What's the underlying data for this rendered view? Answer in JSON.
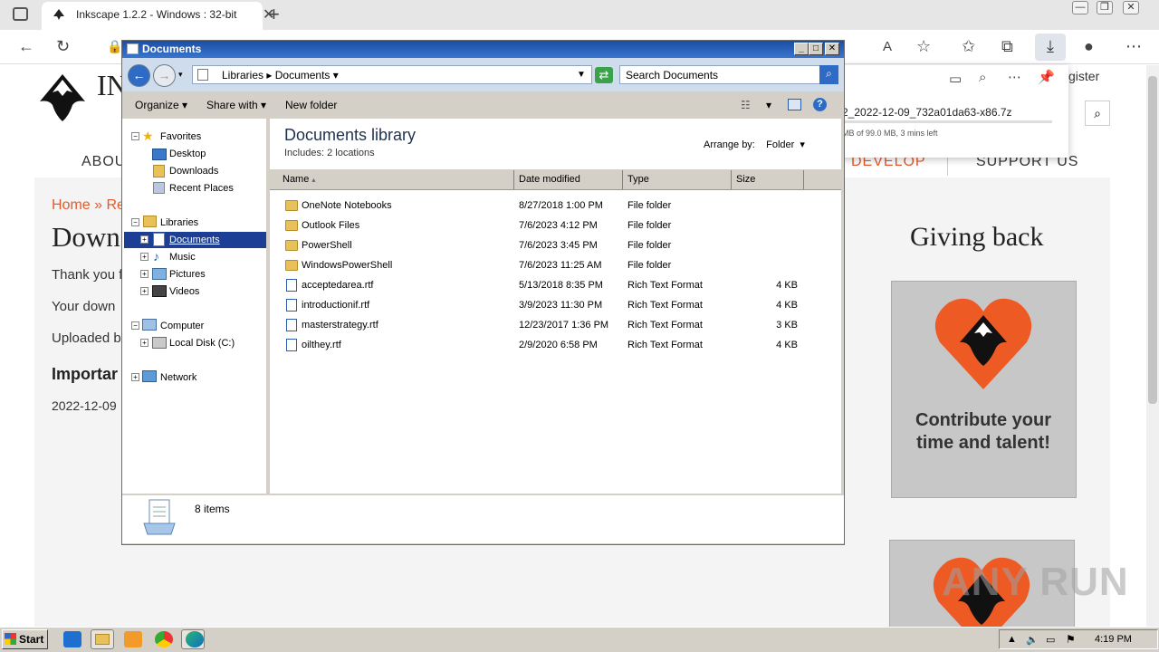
{
  "browser": {
    "tab_title": "Inkscape 1.2.2 - Windows : 32-bit",
    "window_buttons": [
      "—",
      "❐",
      "✕"
    ]
  },
  "webpage": {
    "logo_text": "IN",
    "nav": {
      "about": "ABOU",
      "develop": "DEVELOP",
      "support": "SUPPORT US"
    },
    "breadcrumb": "Home » Rel",
    "heading": "Down",
    "paragraphs": [
      "Thank you f",
      "Your down",
      "Uploaded b"
    ],
    "important": "Importar",
    "date": "2022-12-09",
    "giving_back": "Giving back",
    "card_text": "Contribute your time and talent!",
    "register": "gister"
  },
  "download_panel": {
    "filename": "2_2022-12-09_732a01da63-x86.7z",
    "status": "MB of 99.0 MB, 3 mins left",
    "progress": 0.0
  },
  "explorer": {
    "title": "Documents",
    "address": [
      "Libraries",
      "Documents"
    ],
    "search_placeholder": "Search Documents",
    "toolbar": {
      "organize": "Organize",
      "share": "Share with",
      "new_folder": "New folder"
    },
    "nav": {
      "favorites": "Favorites",
      "desktop": "Desktop",
      "downloads": "Downloads",
      "recent": "Recent Places",
      "libraries": "Libraries",
      "documents": "Documents",
      "music": "Music",
      "pictures": "Pictures",
      "videos": "Videos",
      "computer": "Computer",
      "local_disk": "Local Disk (C:)",
      "network": "Network"
    },
    "library_title": "Documents library",
    "library_sub": "Includes:  2 locations",
    "arrange_label": "Arrange by:",
    "arrange_value": "Folder",
    "columns": [
      "Name",
      "Date modified",
      "Type",
      "Size"
    ],
    "files": [
      {
        "name": "OneNote Notebooks",
        "date": "8/27/2018 1:00 PM",
        "type": "File folder",
        "size": "",
        "kind": "folder"
      },
      {
        "name": "Outlook Files",
        "date": "7/6/2023 4:12 PM",
        "type": "File folder",
        "size": "",
        "kind": "folder"
      },
      {
        "name": "PowerShell",
        "date": "7/6/2023 3:45 PM",
        "type": "File folder",
        "size": "",
        "kind": "folder"
      },
      {
        "name": "WindowsPowerShell",
        "date": "7/6/2023 11:25 AM",
        "type": "File folder",
        "size": "",
        "kind": "folder"
      },
      {
        "name": "acceptedarea.rtf",
        "date": "5/13/2018 8:35 PM",
        "type": "Rich Text Format",
        "size": "4 KB",
        "kind": "file"
      },
      {
        "name": "introductionif.rtf",
        "date": "3/9/2023 11:30 PM",
        "type": "Rich Text Format",
        "size": "4 KB",
        "kind": "file"
      },
      {
        "name": "masterstrategy.rtf",
        "date": "12/23/2017 1:36 PM",
        "type": "Rich Text Format",
        "size": "3 KB",
        "kind": "file"
      },
      {
        "name": "oilthey.rtf",
        "date": "2/9/2020 6:58 PM",
        "type": "Rich Text Format",
        "size": "4 KB",
        "kind": "file"
      }
    ],
    "status": "8 items"
  },
  "taskbar": {
    "start": "Start",
    "clock": "4:19 PM"
  },
  "watermark": "ANY RUN"
}
